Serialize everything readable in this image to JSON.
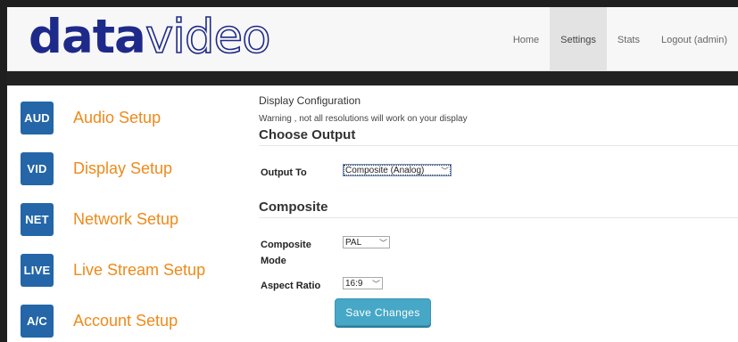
{
  "brand": {
    "logo_bold": "data",
    "logo_thin": "video"
  },
  "nav": [
    {
      "label": "Home",
      "active": false
    },
    {
      "label": "Settings",
      "active": true
    },
    {
      "label": "Stats",
      "active": false
    },
    {
      "label": "Logout (admin)",
      "active": false
    }
  ],
  "sidebar": {
    "items": [
      {
        "badge": "AUD",
        "label": "Audio Setup"
      },
      {
        "badge": "VID",
        "label": "Display Setup"
      },
      {
        "badge": "NET",
        "label": "Network Setup"
      },
      {
        "badge": "LIVE",
        "label": "Live Stream Setup"
      },
      {
        "badge": "A/C",
        "label": "Account Setup"
      }
    ]
  },
  "main": {
    "section_title": "Display Configuration",
    "warning": "Warning , not all resolutions will work on your display",
    "choose_output": {
      "heading": "Choose Output",
      "output_label": "Output To",
      "output_value": "Composite (Analog)"
    },
    "composite": {
      "heading": "Composite",
      "mode_label_line1": "Composite",
      "mode_label_line2": "Mode",
      "mode_value": "PAL",
      "aspect_label": "Aspect Ratio",
      "aspect_value": "16:9"
    },
    "save_label": "Save Changes"
  },
  "colors": {
    "brand_blue": "#1e2a8a",
    "badge_blue": "#2466a8",
    "sidebar_orange": "#ee8a1a",
    "button_teal": "#46a7c7"
  }
}
